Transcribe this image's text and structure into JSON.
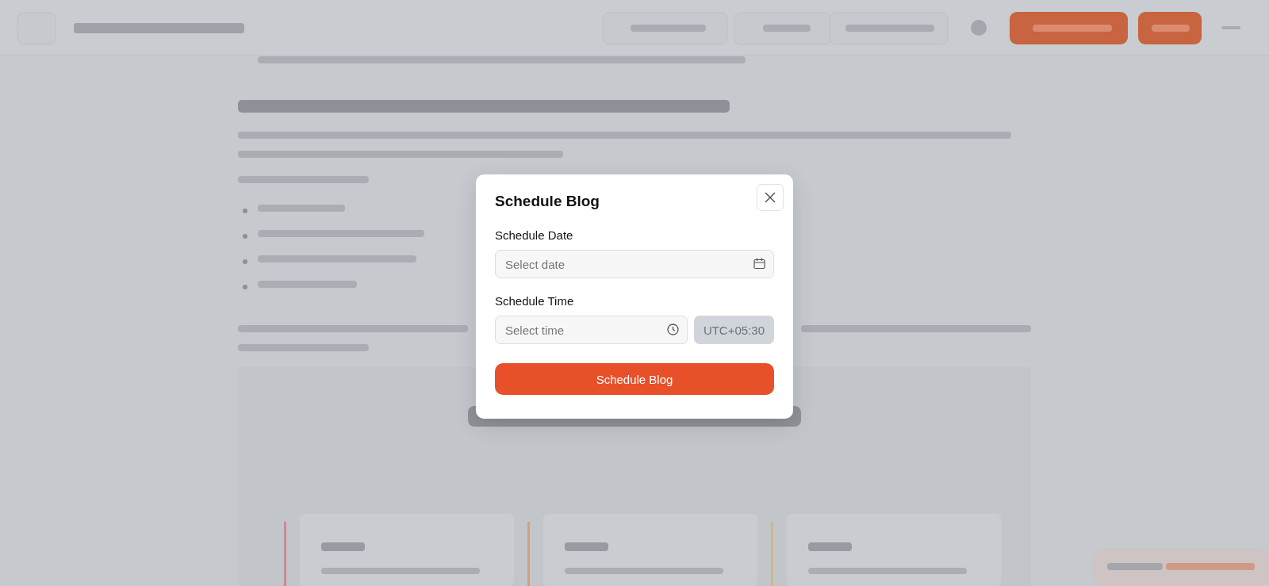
{
  "dialog": {
    "title": "Schedule Blog",
    "date_label": "Schedule Date",
    "date_placeholder": "Select date",
    "time_label": "Schedule Time",
    "time_placeholder": "Select time",
    "timezone": "UTC+05:30",
    "submit": "Schedule Blog"
  }
}
